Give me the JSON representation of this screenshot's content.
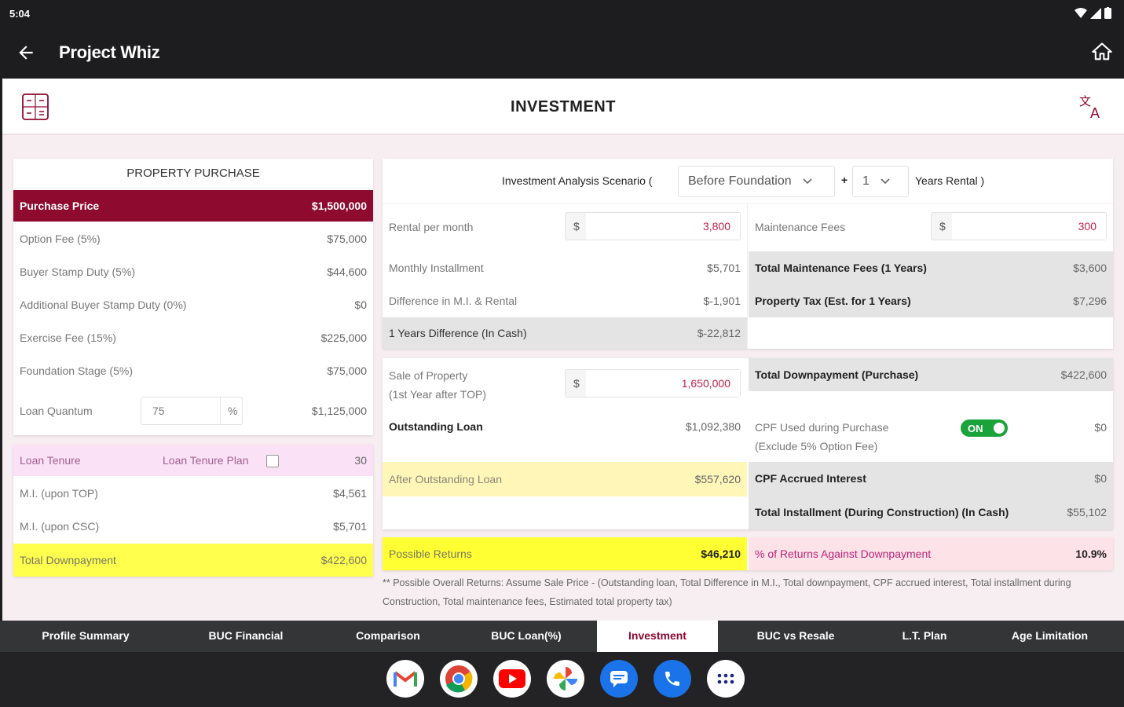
{
  "status": {
    "time": "5:04"
  },
  "app": {
    "title": "Project Whiz"
  },
  "page": {
    "title": "INVESTMENT"
  },
  "property_purchase": {
    "title": "PROPERTY PURCHASE",
    "price_label": "Purchase Price",
    "price_value": "$1,500,000",
    "rows": [
      {
        "label": "Option Fee (5%)",
        "value": "$75,000"
      },
      {
        "label": "Buyer Stamp Duty (5%)",
        "value": "$44,600"
      },
      {
        "label": "Additional Buyer Stamp Duty (0%)",
        "value": "$0"
      },
      {
        "label": "Exercise Fee (15%)",
        "value": "$225,000"
      },
      {
        "label": "Foundation Stage (5%)",
        "value": "$75,000"
      }
    ],
    "loan_quantum_label": "Loan Quantum",
    "loan_quantum_input": "75",
    "loan_quantum_unit": "%",
    "loan_quantum_value": "$1,125,000"
  },
  "loan_tenure": {
    "label": "Loan Tenure",
    "plan_label": "Loan Tenure Plan",
    "value": "30",
    "rows": [
      {
        "label": "M.I. (upon TOP)",
        "value": "$4,561"
      },
      {
        "label": "M.I. (upon CSC)",
        "value": "$5,701"
      }
    ],
    "total_label": "Total Downpayment",
    "total_value": "$422,600"
  },
  "analysis": {
    "scenario_prefix": "Investment Analysis Scenario (",
    "scenario_value": "Before Foundation",
    "plus": "+",
    "years_value": "1",
    "years_suffix": "Years Rental )",
    "rental_label": "Rental per month",
    "currency": "$",
    "rental_value": "3,800",
    "monthly_installment_label": "Monthly Installment",
    "monthly_installment_value": "$5,701",
    "difference_label": "Difference in M.I. & Rental",
    "difference_value": "$-1,901",
    "years_difference_label": "1 Years Difference (In Cash)",
    "years_difference_value": "$-22,812",
    "maintenance_label": "Maintenance Fees",
    "maintenance_value": "300",
    "total_maintenance_label": "Total Maintenance Fees (1 Years)",
    "total_maintenance_value": "$3,600",
    "property_tax_label": "Property Tax (Est. for 1 Years)",
    "property_tax_value": "$7,296"
  },
  "sale": {
    "sale_label_1": "Sale of Property",
    "sale_label_2": "(1st Year after TOP)",
    "currency": "$",
    "sale_value": "1,650,000",
    "outstanding_label": "Outstanding Loan",
    "outstanding_value": "$1,092,380",
    "after_outstanding_label": "After Outstanding Loan",
    "after_outstanding_value": "$557,620",
    "total_downpayment_label": "Total Downpayment (Purchase)",
    "total_downpayment_value": "$422,600",
    "cpf_label_1": "CPF Used during Purchase",
    "cpf_label_2": "(Exclude 5% Option Fee)",
    "cpf_toggle": "ON",
    "cpf_value": "$0",
    "cpf_interest_label": "CPF Accrued Interest",
    "cpf_interest_value": "$0",
    "total_installment_label": "Total Installment (During Construction) (In Cash)",
    "total_installment_value": "$55,102"
  },
  "returns": {
    "label": "Possible Returns",
    "value": "$46,210",
    "pct_label": "% of Returns Against Downpayment",
    "pct_value": "10.9%"
  },
  "footnote": "** Possible Overall Returns: Assume Sale Price - (Outstanding loan, Total Difference in M.I., Total downpayment, CPF accrued interest, Total installment during Construction, Total maintenance fees, Estimated total property tax)",
  "tabs": [
    {
      "label": "Profile Summary"
    },
    {
      "label": "BUC Financial"
    },
    {
      "label": "Comparison"
    },
    {
      "label": "BUC Loan(%)"
    },
    {
      "label": "Investment"
    },
    {
      "label": "BUC vs Resale"
    },
    {
      "label": "L.T. Plan"
    },
    {
      "label": "Age Limitation"
    }
  ],
  "dock": [
    {
      "icon": "gmail-icon"
    },
    {
      "icon": "chrome-icon"
    },
    {
      "icon": "youtube-icon"
    },
    {
      "icon": "photos-icon"
    },
    {
      "icon": "messages-icon"
    },
    {
      "icon": "phone-icon"
    },
    {
      "icon": "apps-icon"
    }
  ],
  "colors": {
    "accent": "#8e0a2f",
    "highlight": "#ffff4d",
    "pink": "#fbe1f5",
    "toggle": "#1aa33a"
  }
}
